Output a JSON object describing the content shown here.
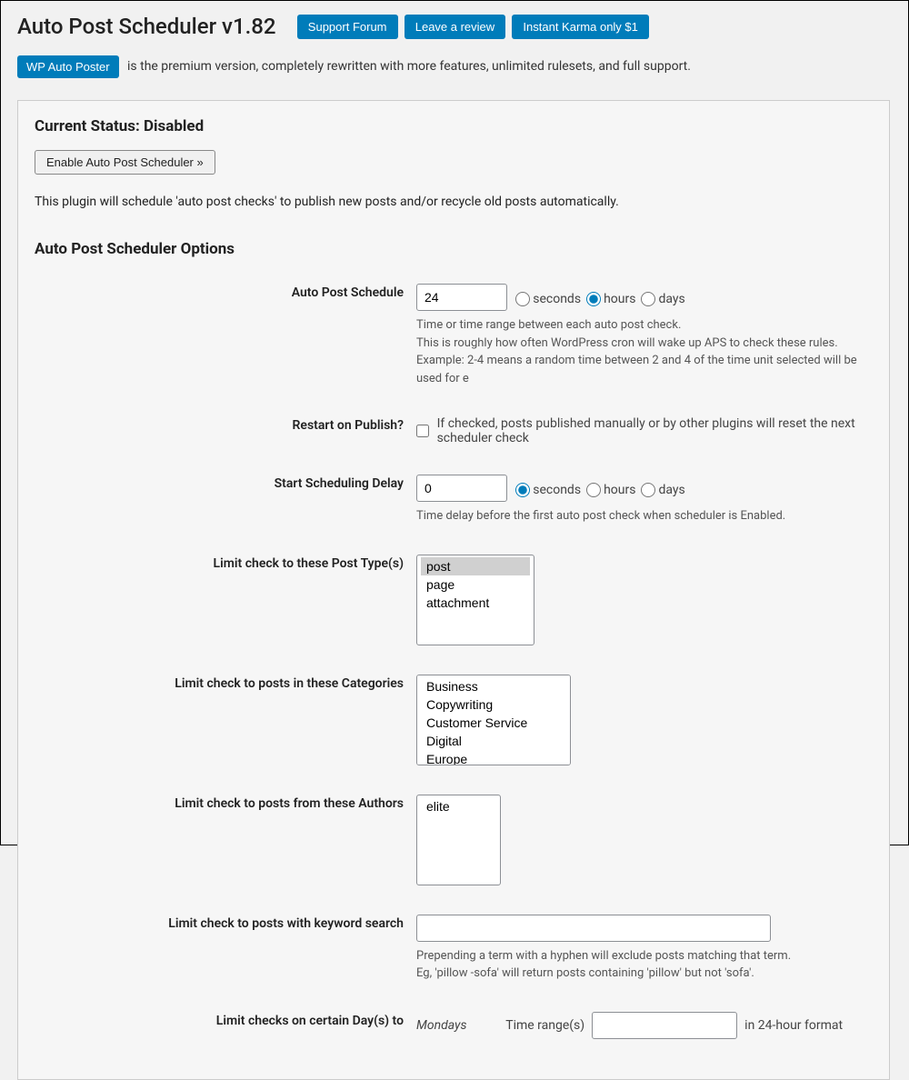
{
  "header": {
    "title": "Auto Post Scheduler v1.82",
    "buttons": {
      "support": "Support Forum",
      "review": "Leave a review",
      "karma": "Instant Karma only $1"
    }
  },
  "premium": {
    "button": "WP Auto Poster",
    "text": " is the premium version, completely rewritten with more features, unlimited rulesets, and full support."
  },
  "status": {
    "heading": "Current Status: Disabled",
    "enable_button": "Enable Auto Post Scheduler »",
    "description": "This plugin will schedule 'auto post checks' to publish new posts and/or recycle old posts automatically."
  },
  "options": {
    "heading": "Auto Post Scheduler Options",
    "schedule": {
      "label": "Auto Post Schedule",
      "value": "24",
      "radios": {
        "seconds": "seconds",
        "hours": "hours",
        "days": "days"
      },
      "selected": "hours",
      "desc1": "Time or time range between each auto post check.",
      "desc2": "This is roughly how often WordPress cron will wake up APS to check these rules.",
      "desc3": "Example: 2-4 means a random time between 2 and 4 of the time unit selected will be used for e"
    },
    "restart": {
      "label": "Restart on Publish?",
      "desc": "If checked, posts published manually or by other plugins will reset the next scheduler check"
    },
    "delay": {
      "label": "Start Scheduling Delay",
      "value": "0",
      "radios": {
        "seconds": "seconds",
        "hours": "hours",
        "days": "days"
      },
      "selected": "seconds",
      "desc": "Time delay before the first auto post check when scheduler is Enabled."
    },
    "post_types": {
      "label": "Limit check to these Post Type(s)",
      "options": [
        "post",
        "page",
        "attachment"
      ],
      "selected": "post"
    },
    "categories": {
      "label": "Limit check to posts in these Categories",
      "options": [
        "Business",
        "Copywriting",
        "Customer Service",
        "Digital",
        "Europe"
      ]
    },
    "authors": {
      "label": "Limit check to posts from these Authors",
      "options": [
        "elite"
      ]
    },
    "keyword": {
      "label": "Limit check to posts with keyword search",
      "desc1": "Prepending a term with a hyphen will exclude posts matching that term.",
      "desc2": "Eg, 'pillow -sofa' will return posts containing 'pillow' but not 'sofa'."
    },
    "days": {
      "label": "Limit checks on certain Day(s) to",
      "day": "Mondays",
      "time_label": "Time range(s)",
      "suffix": "in 24-hour format"
    }
  }
}
